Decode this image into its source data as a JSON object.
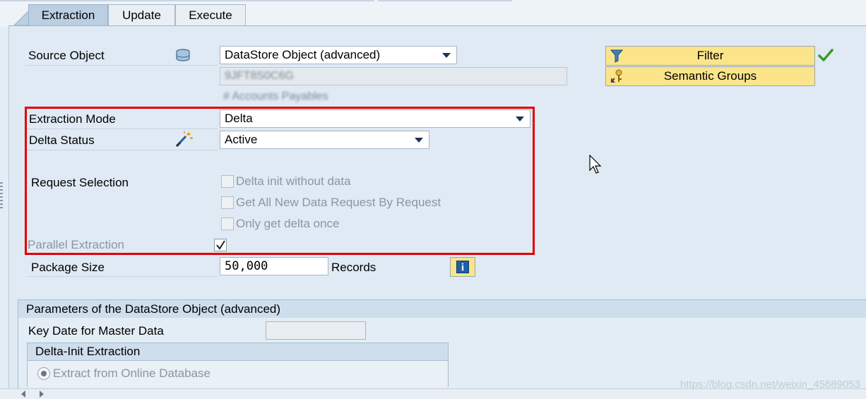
{
  "tabs": [
    {
      "label": "Extraction",
      "active": true
    },
    {
      "label": "Update",
      "active": false
    },
    {
      "label": "Execute",
      "active": false
    }
  ],
  "source": {
    "label": "Source Object",
    "icon": "database-icon",
    "type_value": "DataStore Object (advanced)",
    "object_name": "9JFT8S0C6G",
    "object_desc": "# Accounts Payables"
  },
  "buttons": {
    "filter": "Filter",
    "semantic_groups": "Semantic Groups",
    "filter_icon": "funnel-icon",
    "semantic_icon": "key-group-icon",
    "status_icon": "green-check-icon"
  },
  "extraction": {
    "mode_label": "Extraction Mode",
    "mode_value": "Delta",
    "delta_status_label": "Delta Status",
    "delta_status_value": "Active",
    "delta_status_icon": "magic-wand-icon",
    "request_selection_label": "Request Selection",
    "options": [
      {
        "label": "Delta init without data",
        "checked": false,
        "enabled": false
      },
      {
        "label": "Get All New Data Request By Request",
        "checked": false,
        "enabled": false
      },
      {
        "label": "Only get delta once",
        "checked": false,
        "enabled": false
      }
    ],
    "parallel_label": "Parallel Extraction",
    "parallel_checked": true
  },
  "package": {
    "label": "Package Size",
    "value": "50,000",
    "unit": "Records",
    "info_icon": "info-icon"
  },
  "params": {
    "title": "Parameters of the DataStore Object (advanced)",
    "key_date_label": "Key Date for Master Data",
    "key_date_value": "",
    "delta_init_title": "Delta-Init Extraction",
    "extract_online_label": "Extract from Online Database",
    "extract_online_selected": true
  },
  "watermark": "https://blog.csdn.net/weixin_45689053",
  "colors": {
    "highlight_box": "#e00000",
    "button_yellow": "#fbe48a",
    "panel_bg": "#dfeaf4",
    "check_green": "#3a9a2e"
  }
}
